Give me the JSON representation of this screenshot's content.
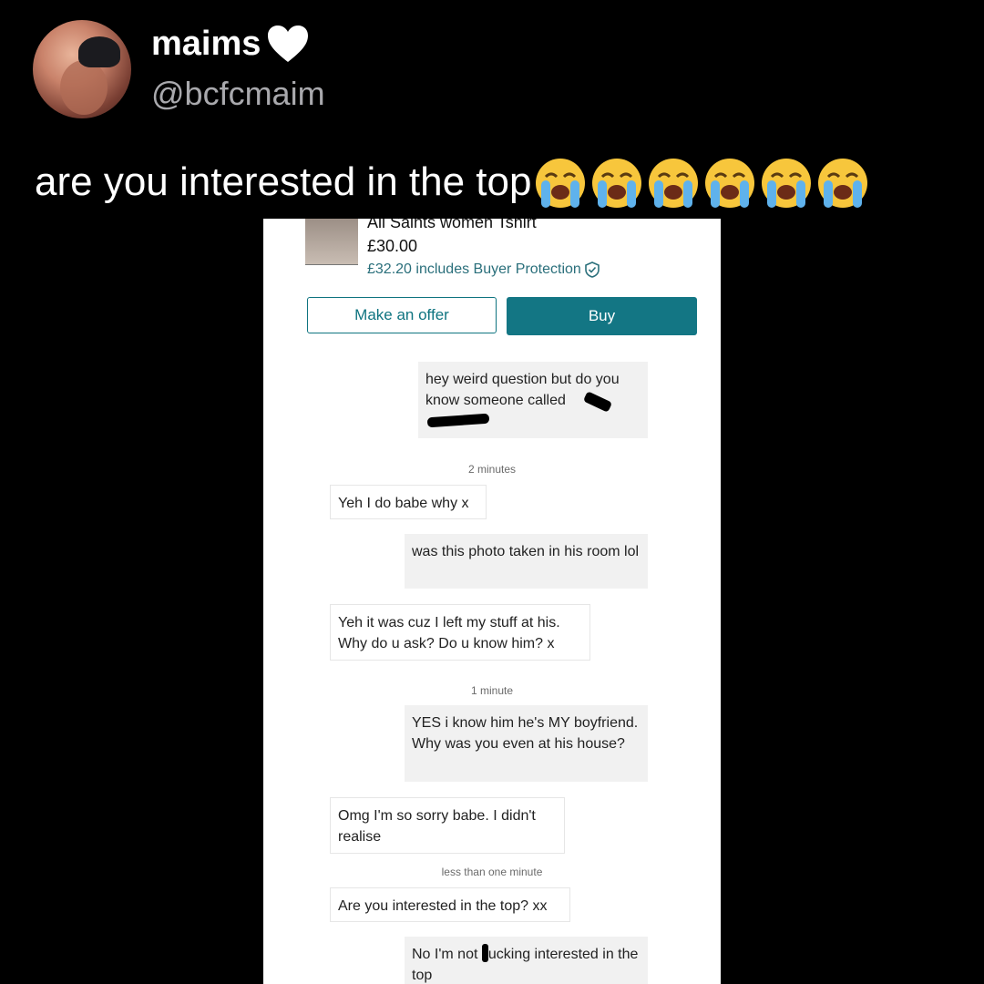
{
  "tweet": {
    "name": "maims",
    "handle": "@bcfcmaim",
    "text": "are you interested in the top",
    "emojis": [
      "loudly-crying-face",
      "loudly-crying-face",
      "loudly-crying-face",
      "loudly-crying-face",
      "loudly-crying-face",
      "loudly-crying-face"
    ]
  },
  "listing": {
    "title": "All Saints women Tshirt",
    "price": "£30.00",
    "protection_text": "£32.20 includes Buyer Protection",
    "offer_label": "Make an offer",
    "buy_label": "Buy",
    "accent": "#137684"
  },
  "chat": {
    "messages": [
      {
        "side": "out",
        "text": "hey weird question but do you know someone called"
      },
      {
        "side": "in",
        "text": "Yeh I do babe why x"
      },
      {
        "side": "out",
        "text": "was this photo taken in his room lol"
      },
      {
        "side": "in",
        "text": "Yeh it was cuz I left my stuff at his. Why do u ask? Do u know him? x"
      },
      {
        "side": "out",
        "text": "YES i know him he's MY boyfriend. Why was you even at his house?"
      },
      {
        "side": "in",
        "text": "Omg I'm so sorry babe. I didn't realise"
      },
      {
        "side": "in",
        "text": "Are you interested in the top? xx"
      },
      {
        "side": "out",
        "text_before": "No I'm not ",
        "text_after": "ucking interested in the top"
      }
    ],
    "timestamps": [
      "2 minutes",
      "1 minute",
      "less than one minute"
    ]
  }
}
